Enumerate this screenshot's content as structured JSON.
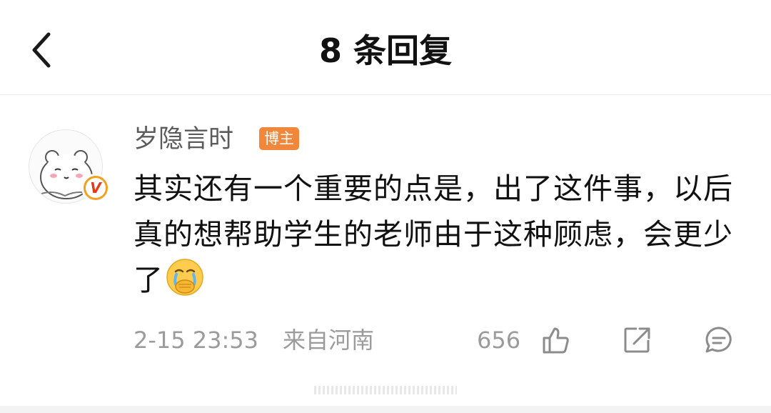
{
  "header": {
    "title": "8 条回复",
    "back_icon": "chevron-left-icon"
  },
  "comment": {
    "username": "岁隐言时",
    "author_badge": "博主",
    "text": "其实还有一个重要的点是，出了这件事，以后真的想帮助学生的老师由于这种顾虑，会更少了",
    "emoji": "crying-hand-over-mouth-emoji",
    "time": "2-15 23:53",
    "location": "来自河南",
    "likes": "656",
    "verified_label": "V"
  },
  "colors": {
    "author_badge": "#f0873b",
    "verified": "#f2a01e",
    "meta_text": "#9b9b9b"
  }
}
